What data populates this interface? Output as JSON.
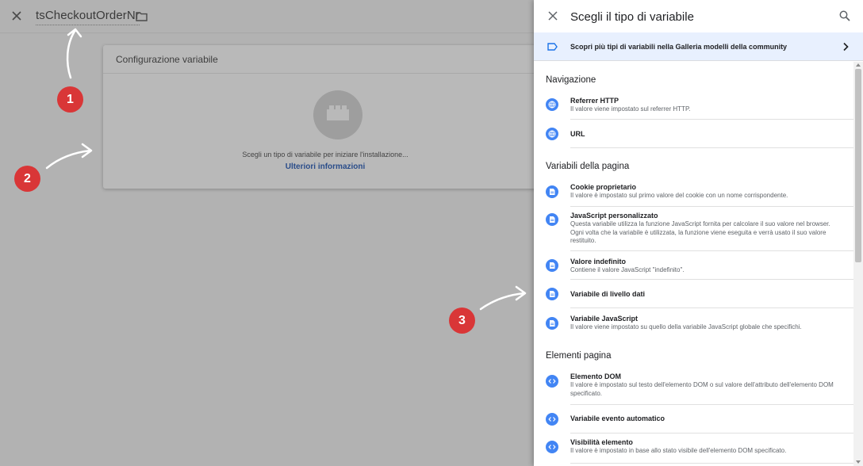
{
  "editor": {
    "variable_name": "tsCheckoutOrderNr",
    "config_title": "Configurazione variabile",
    "config_hint": "Scegli un tipo di variabile per iniziare l'installazione...",
    "config_link": "Ulteriori informazioni"
  },
  "annotations": [
    "1",
    "2",
    "3"
  ],
  "panel": {
    "title": "Scegli il tipo di variabile",
    "gallery_text": "Scopri più tipi di variabili nella Galleria modelli della community",
    "sections": [
      {
        "title": "Navigazione",
        "items": [
          {
            "title": "Referrer HTTP",
            "desc": "Il valore viene impostato sul referrer HTTP.",
            "icon": "globe-icon"
          },
          {
            "title": "URL",
            "desc": "",
            "icon": "globe-icon"
          }
        ]
      },
      {
        "title": "Variabili della pagina",
        "items": [
          {
            "title": "Cookie proprietario",
            "desc": "Il valore è impostato sul primo valore del cookie con un nome corrispondente.",
            "icon": "document-icon"
          },
          {
            "title": "JavaScript personalizzato",
            "desc": "Questa variabile utilizza la funzione JavaScript fornita per calcolare il suo valore nel browser. Ogni volta che la variabile è utilizzata, la funzione viene eseguita e verrà usato il suo valore restituito.",
            "icon": "document-icon"
          },
          {
            "title": "Valore indefinito",
            "desc": "Contiene il valore JavaScript \"indefinito\".",
            "icon": "document-icon"
          },
          {
            "title": "Variabile di livello dati",
            "desc": "",
            "icon": "document-icon"
          },
          {
            "title": "Variabile JavaScript",
            "desc": "Il valore viene impostato su quello della variabile JavaScript globale che specifichi.",
            "icon": "document-icon"
          }
        ]
      },
      {
        "title": "Elementi pagina",
        "items": [
          {
            "title": "Elemento DOM",
            "desc": "Il valore è impostato sul testo dell'elemento DOM o sul valore dell'attributo dell'elemento DOM specificato.",
            "icon": "code-icon"
          },
          {
            "title": "Variabile evento automatico",
            "desc": "",
            "icon": "code-icon"
          },
          {
            "title": "Visibilità elemento",
            "desc": "Il valore è impostato in base allo stato visibile dell'elemento DOM specificato.",
            "icon": "code-icon"
          }
        ]
      }
    ]
  }
}
